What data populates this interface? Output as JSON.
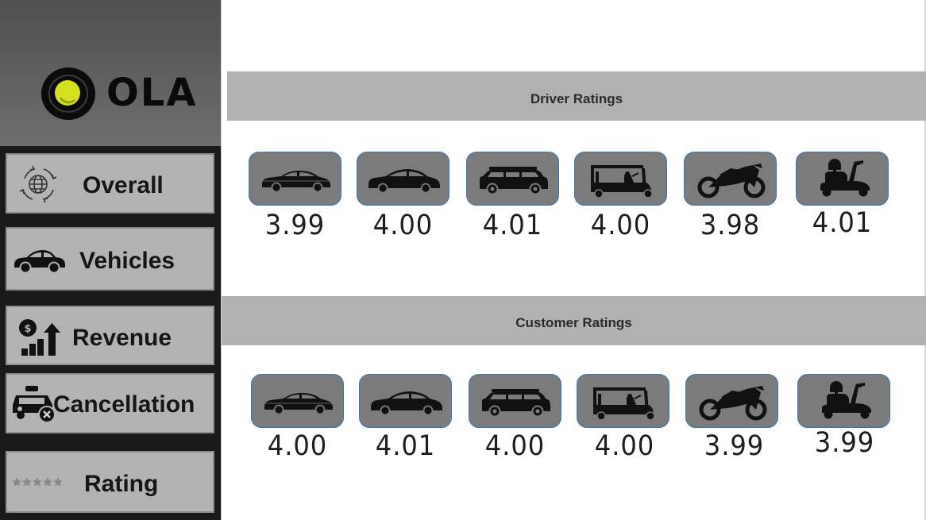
{
  "brand": {
    "logo_text": "OLA",
    "accent": "#d4e020"
  },
  "sidebar": {
    "items": [
      {
        "label": "Overall",
        "icon": "globe-arrows-icon"
      },
      {
        "label": "Vehicles",
        "icon": "car-icon"
      },
      {
        "label": "Revenue",
        "icon": "revenue-chart-icon"
      },
      {
        "label": "Cancellation",
        "icon": "taxi-cancel-icon"
      },
      {
        "label": "Rating",
        "icon": "stars-icon"
      }
    ]
  },
  "driver_ratings": {
    "title": "Driver Ratings",
    "vehicles": [
      {
        "icon": "sedan-icon",
        "rating": "3.99"
      },
      {
        "icon": "prime-sedan-icon",
        "rating": "4.00"
      },
      {
        "icon": "suv-icon",
        "rating": "4.01"
      },
      {
        "icon": "auto-rickshaw-icon",
        "rating": "4.00"
      },
      {
        "icon": "bike-icon",
        "rating": "3.98"
      },
      {
        "icon": "ebike-scooter-icon",
        "rating": "4.01"
      }
    ]
  },
  "customer_ratings": {
    "title": "Customer Ratings",
    "vehicles": [
      {
        "icon": "sedan-icon",
        "rating": "4.00"
      },
      {
        "icon": "prime-sedan-icon",
        "rating": "4.01"
      },
      {
        "icon": "suv-icon",
        "rating": "4.00"
      },
      {
        "icon": "auto-rickshaw-icon",
        "rating": "4.00"
      },
      {
        "icon": "bike-icon",
        "rating": "3.99"
      },
      {
        "icon": "ebike-scooter-icon",
        "rating": "3.99"
      }
    ]
  }
}
